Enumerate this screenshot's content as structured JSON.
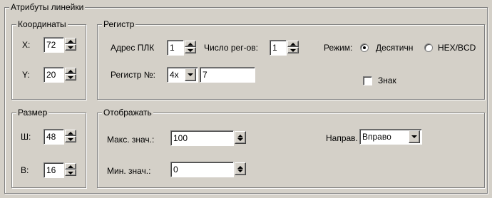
{
  "ruler_attributes": {
    "title": "Атрибуты линейки",
    "coordinates": {
      "title": "Координаты",
      "x_label": "X:",
      "x_value": "72",
      "y_label": "Y:",
      "y_value": "20"
    },
    "register": {
      "title": "Регистр",
      "plc_address_label": "Адрес ПЛК",
      "plc_address_value": "1",
      "reg_count_label": "Число рег-ов:",
      "reg_count_value": "1",
      "mode_label": "Режим:",
      "mode_decimal_label": "Десятичн",
      "mode_hex_label": "HEX/BCD",
      "mode_selected": "decimal",
      "register_no_label": "Регистр №:",
      "register_type_value": "4x",
      "register_number_value": "7",
      "sign_label": "Знак",
      "sign_checked": false
    },
    "size": {
      "title": "Размер",
      "w_label": "Ш:",
      "w_value": "48",
      "h_label": "В:",
      "h_value": "16"
    },
    "display": {
      "title": "Отображать",
      "max_label": "Макс. знач.:",
      "max_value": "100",
      "min_label": "Мин. знач.:",
      "min_value": "0",
      "direction_label": "Направ.",
      "direction_value": "Вправо"
    }
  }
}
